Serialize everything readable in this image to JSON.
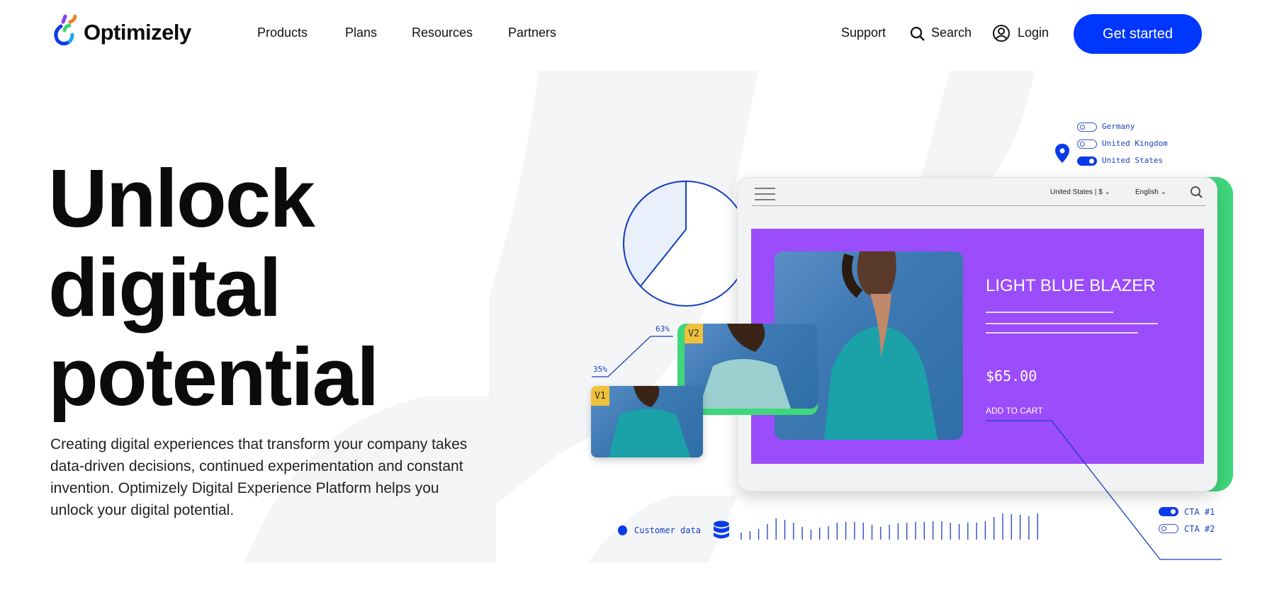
{
  "header": {
    "logo": "Optimizely",
    "nav": [
      "Products",
      "Plans",
      "Resources",
      "Partners"
    ],
    "support": "Support",
    "search": "Search",
    "login": "Login",
    "cta": "Get started"
  },
  "hero": {
    "title_lines": [
      "Unlock",
      "digital",
      "potential"
    ],
    "description": "Creating digital experiences that transform your company takes data-driven decisions, continued experimentation and constant invention. Optimizely Digital Experience Platform helps you unlock your digital potential."
  },
  "illustration": {
    "locations": [
      {
        "label": "Germany",
        "on": false
      },
      {
        "label": "United Kingdom",
        "on": false
      },
      {
        "label": "United States",
        "on": true
      }
    ],
    "mock_header": {
      "region": "United States | $",
      "language": "English"
    },
    "product": {
      "name": "LIGHT BLUE BLAZER",
      "price": "$65.00",
      "add_to_cart": "ADD TO CART"
    },
    "variants": [
      {
        "label": "V1",
        "percent": "35%"
      },
      {
        "label": "V2",
        "percent": "63%"
      }
    ],
    "pie_share_percent": 37,
    "customer_data": "Customer data",
    "ctas": [
      {
        "label": "CTA #1",
        "on": true
      },
      {
        "label": "CTA #2",
        "on": false
      }
    ],
    "colors": {
      "brand": "#0037ff",
      "purple": "#9b4cfb",
      "green": "#3fd77b",
      "badge": "#f0c23c"
    }
  }
}
